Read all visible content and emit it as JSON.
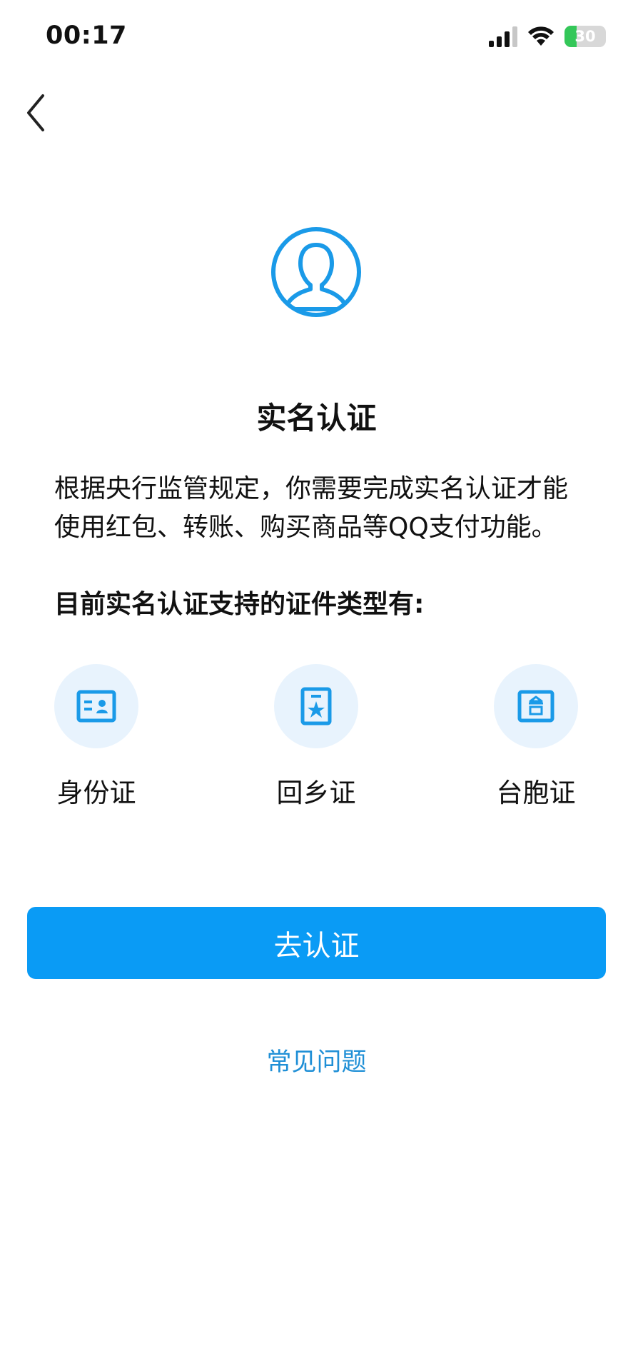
{
  "status_bar": {
    "time": "00:17",
    "battery_level": "30",
    "battery_fraction": 0.3,
    "icons": [
      "cellular-signal-icon",
      "wifi-icon",
      "battery-charging-icon"
    ]
  },
  "nav": {
    "back_icon": "chevron-left-icon"
  },
  "header": {
    "avatar_icon": "user-avatar-icon",
    "title": "实名认证"
  },
  "content": {
    "description": "根据央行监管规定，你需要完成实名认证才能使用红包、转账、购买商品等QQ支付功能。",
    "supported_heading": "目前实名认证支持的证件类型有:"
  },
  "id_types": [
    {
      "label": "身份证",
      "icon": "id-card-icon"
    },
    {
      "label": "回乡证",
      "icon": "home-return-permit-icon"
    },
    {
      "label": "台胞证",
      "icon": "taiwan-compatriot-permit-icon"
    }
  ],
  "actions": {
    "verify_label": "去认证",
    "faq_label": "常见问题"
  },
  "colors": {
    "accent": "#0a9bf5",
    "icon_blue": "#1a9ae8",
    "icon_bg": "#e8f3fd",
    "link": "#1f8fd6",
    "battery_green": "#34c759"
  }
}
